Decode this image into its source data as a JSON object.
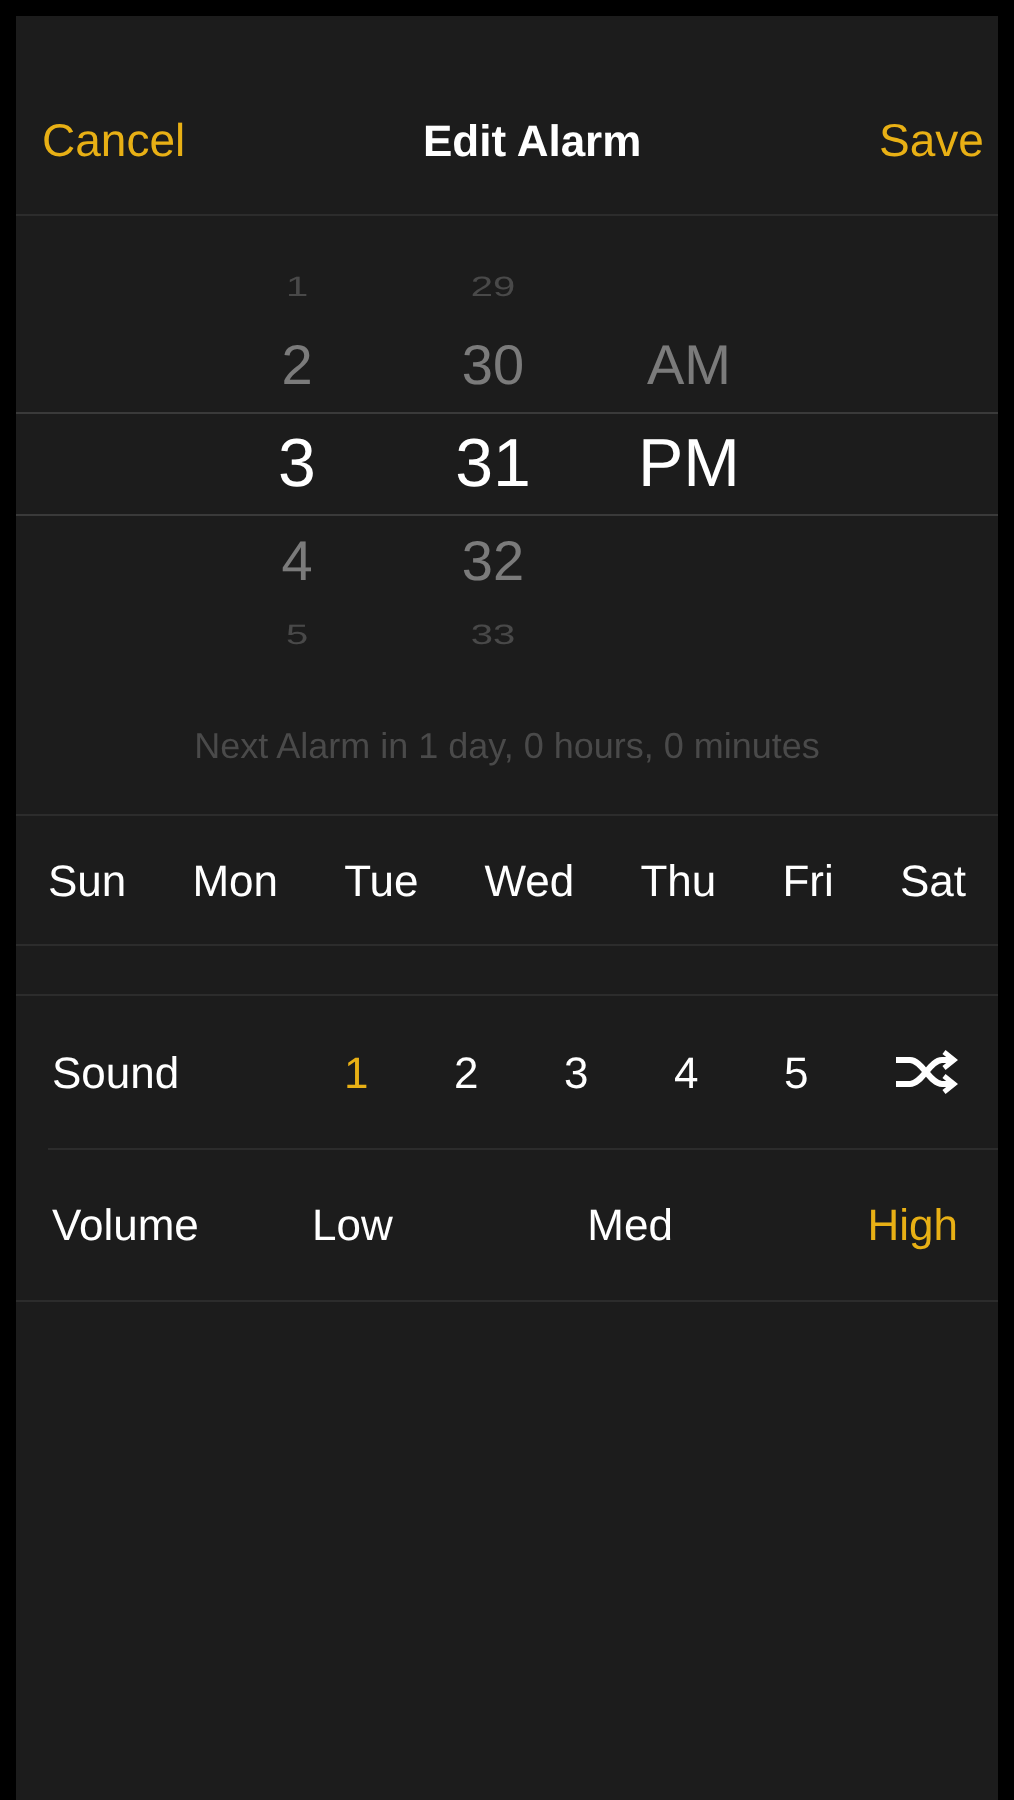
{
  "nav": {
    "cancel": "Cancel",
    "title": "Edit Alarm",
    "save": "Save"
  },
  "picker": [
    {
      "items": [
        {
          "label": "1",
          "selected": false
        },
        {
          "label": "2",
          "selected": false
        },
        {
          "label": "3",
          "selected": true
        },
        {
          "label": "4",
          "selected": false
        },
        {
          "label": "5",
          "selected": false
        }
      ]
    },
    {
      "items": [
        {
          "label": "29",
          "selected": false
        },
        {
          "label": "30",
          "selected": false
        },
        {
          "label": "31",
          "selected": true
        },
        {
          "label": "32",
          "selected": false
        },
        {
          "label": "33",
          "selected": false
        }
      ]
    },
    {
      "items": [
        {
          "label": "AM",
          "selected": false
        },
        {
          "label": "PM",
          "selected": true
        }
      ]
    }
  ],
  "next_alarm": "Next Alarm in 1 day, 0 hours, 0 minutes",
  "days": [
    "Sun",
    "Mon",
    "Tue",
    "Wed",
    "Thu",
    "Fri",
    "Sat"
  ],
  "sound": {
    "label": "Sound",
    "options": [
      {
        "kind": "number",
        "label": "1",
        "selected": true
      },
      {
        "kind": "number",
        "label": "2",
        "selected": false
      },
      {
        "kind": "number",
        "label": "3",
        "selected": false
      },
      {
        "kind": "number",
        "label": "4",
        "selected": false
      },
      {
        "kind": "number",
        "label": "5",
        "selected": false
      },
      {
        "kind": "shuffle",
        "selected": false
      }
    ]
  },
  "volume": {
    "label": "Volume",
    "options": [
      {
        "label": "Low",
        "selected": false
      },
      {
        "label": "Med",
        "selected": false
      },
      {
        "label": "High",
        "selected": true
      }
    ]
  }
}
